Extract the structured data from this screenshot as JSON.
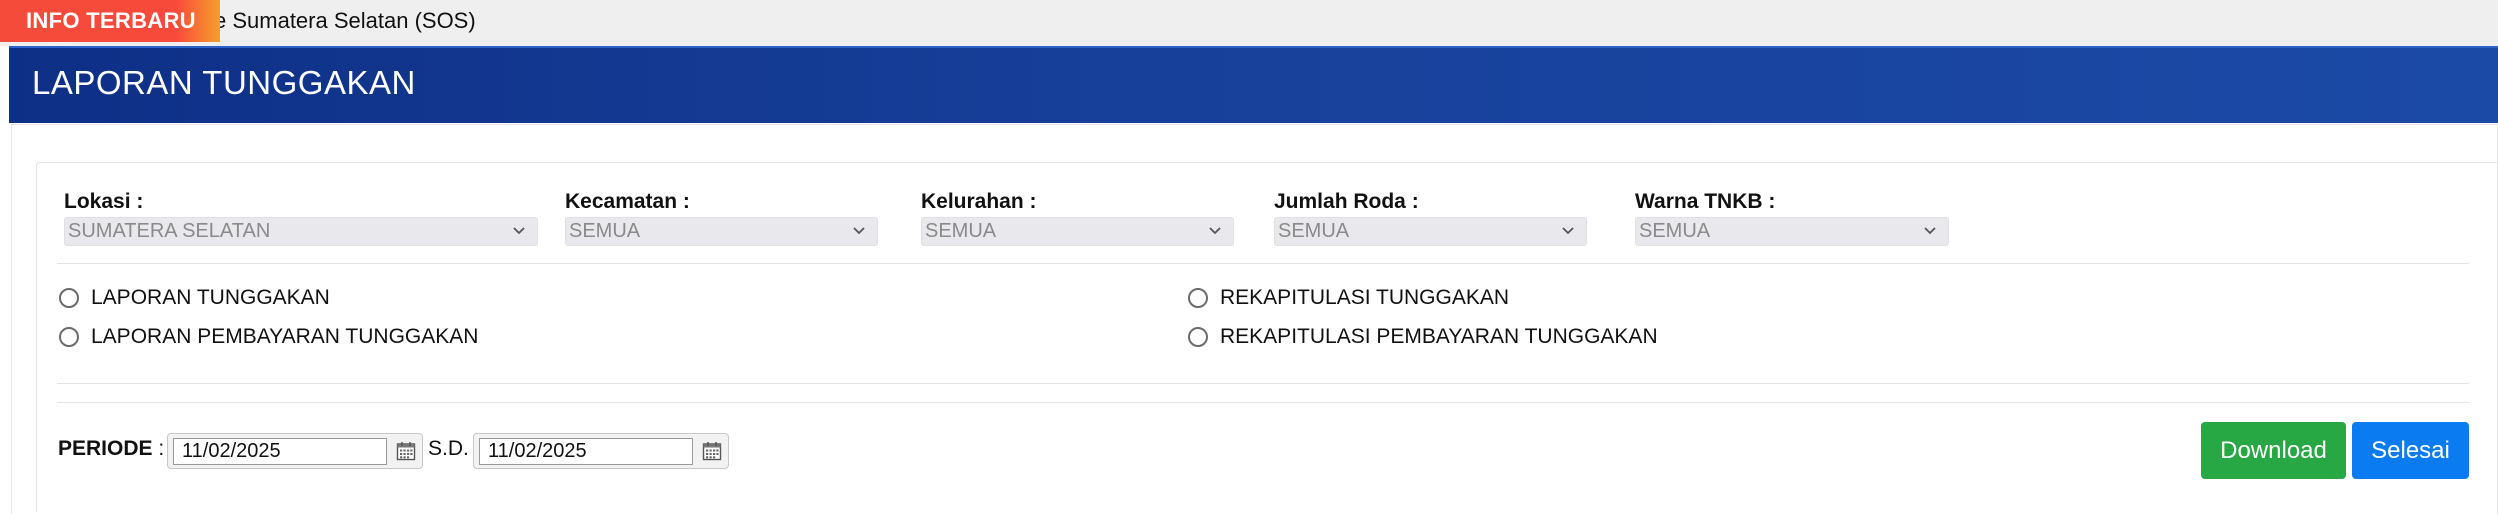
{
  "ticker": {
    "badge": "INFO TERBARU",
    "text": "e Sumatera Selatan (SOS)"
  },
  "header": {
    "title": "LAPORAN TUNGGAKAN"
  },
  "filters": {
    "lokasi": {
      "label": "Lokasi :",
      "value": "SUMATERA SELATAN"
    },
    "kecamatan": {
      "label": "Kecamatan :",
      "value": "SEMUA"
    },
    "kelurahan": {
      "label": "Kelurahan :",
      "value": "SEMUA"
    },
    "roda": {
      "label": "Jumlah Roda :",
      "value": "SEMUA"
    },
    "tnkb": {
      "label": "Warna TNKB :",
      "value": "SEMUA"
    }
  },
  "reports": {
    "laporan_tunggakan": "LAPORAN TUNGGAKAN",
    "laporan_pembayaran": "LAPORAN PEMBAYARAN TUNGGAKAN",
    "rekap_tunggakan": "REKAPITULASI TUNGGAKAN",
    "rekap_pembayaran": "REKAPITULASI PEMBAYARAN TUNGGAKAN"
  },
  "periode": {
    "label": "PERIODE",
    "colon": " :",
    "from": "11/02/2025",
    "sd": "S.D.",
    "to": "11/02/2025"
  },
  "buttons": {
    "download": "Download",
    "selesai": "Selesai"
  },
  "colors": {
    "header": "#17409a",
    "ticker_badge": "#f84a3a",
    "download": "#28a745",
    "selesai": "#0b7bf2"
  }
}
